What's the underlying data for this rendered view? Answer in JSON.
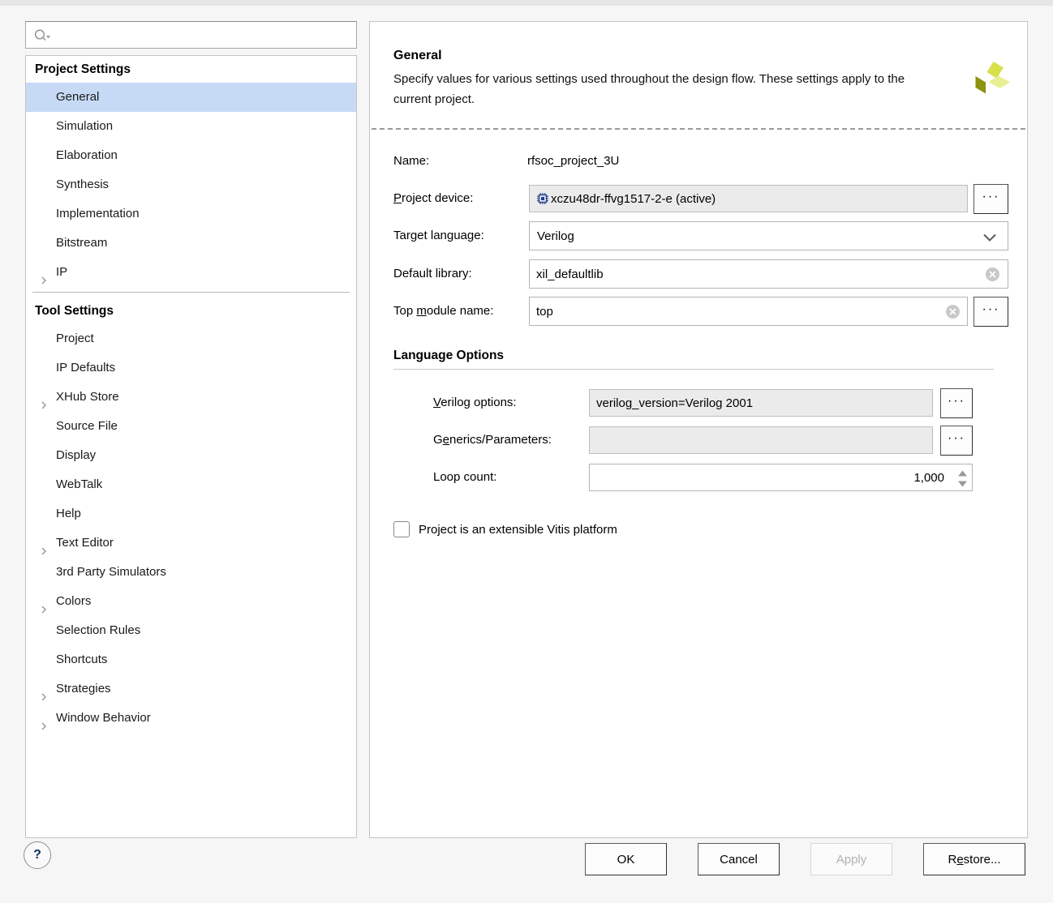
{
  "search": {
    "placeholder": "",
    "value": "",
    "icon": "search-icon"
  },
  "sidebar": {
    "groups": [
      {
        "title": "Project Settings",
        "items": [
          {
            "label": "General",
            "expandable": false,
            "selected": true
          },
          {
            "label": "Simulation",
            "expandable": false,
            "selected": false
          },
          {
            "label": "Elaboration",
            "expandable": false,
            "selected": false
          },
          {
            "label": "Synthesis",
            "expandable": false,
            "selected": false
          },
          {
            "label": "Implementation",
            "expandable": false,
            "selected": false
          },
          {
            "label": "Bitstream",
            "expandable": false,
            "selected": false
          },
          {
            "label": "IP",
            "expandable": true,
            "selected": false
          }
        ]
      },
      {
        "title": "Tool Settings",
        "items": [
          {
            "label": "Project",
            "expandable": false,
            "selected": false
          },
          {
            "label": "IP Defaults",
            "expandable": false,
            "selected": false
          },
          {
            "label": "XHub Store",
            "expandable": true,
            "selected": false
          },
          {
            "label": "Source File",
            "expandable": false,
            "selected": false
          },
          {
            "label": "Display",
            "expandable": false,
            "selected": false
          },
          {
            "label": "WebTalk",
            "expandable": false,
            "selected": false
          },
          {
            "label": "Help",
            "expandable": false,
            "selected": false
          },
          {
            "label": "Text Editor",
            "expandable": true,
            "selected": false
          },
          {
            "label": "3rd Party Simulators",
            "expandable": false,
            "selected": false
          },
          {
            "label": "Colors",
            "expandable": true,
            "selected": false
          },
          {
            "label": "Selection Rules",
            "expandable": false,
            "selected": false
          },
          {
            "label": "Shortcuts",
            "expandable": false,
            "selected": false
          },
          {
            "label": "Strategies",
            "expandable": true,
            "selected": false
          },
          {
            "label": "Window Behavior",
            "expandable": true,
            "selected": false
          }
        ]
      }
    ]
  },
  "panel": {
    "title": "General",
    "description": "Specify values for various settings used throughout the design flow. These settings apply to the current project.",
    "logo": "xilinx-logo-icon"
  },
  "form": {
    "name": {
      "label": "Name:",
      "value": "rfsoc_project_3U"
    },
    "project_device": {
      "label_pre": "P",
      "label_post": "roject device:",
      "value": "xczu48dr-ffvg1517-2-e (active)",
      "icon": "chip-icon",
      "browse_label": "···"
    },
    "target_language": {
      "label": "Target language:",
      "value": "Verilog",
      "options": [
        "Verilog"
      ]
    },
    "default_library": {
      "label": "Default library:",
      "value": "xil_defaultlib"
    },
    "top_module_name": {
      "label_pre": "Top ",
      "label_mn": "m",
      "label_post": "odule name:",
      "value": "top",
      "browse_label": "···"
    }
  },
  "language_options": {
    "title": "Language Options",
    "verilog_options": {
      "label_pre": "V",
      "label_post": "erilog options:",
      "value": "verilog_version=Verilog 2001",
      "browse_label": "···"
    },
    "generics_parameters": {
      "label_pre": "G",
      "label_mn": "e",
      "label_post": "nerics/Parameters:",
      "value": "",
      "browse_label": "···"
    },
    "loop_count": {
      "label": "Loop count:",
      "value": "1,000"
    }
  },
  "vitis": {
    "label": "Project is an extensible Vitis platform",
    "checked": false
  },
  "footer": {
    "help_label": "?",
    "ok_label": "OK",
    "cancel_label": "Cancel",
    "apply_label": "Apply",
    "apply_disabled": true,
    "restore_label_pre": "R",
    "restore_label_mn": "e",
    "restore_label_post": "store..."
  },
  "colors": {
    "selection": "#c6daf5",
    "panel_bg": "#ffffff",
    "dialog_bg": "#f6f6f6",
    "readonly_field": "#ebebeb",
    "logo_dark": "#8d9210",
    "logo_mid": "#d8e04a",
    "logo_light": "#e9ef92"
  }
}
